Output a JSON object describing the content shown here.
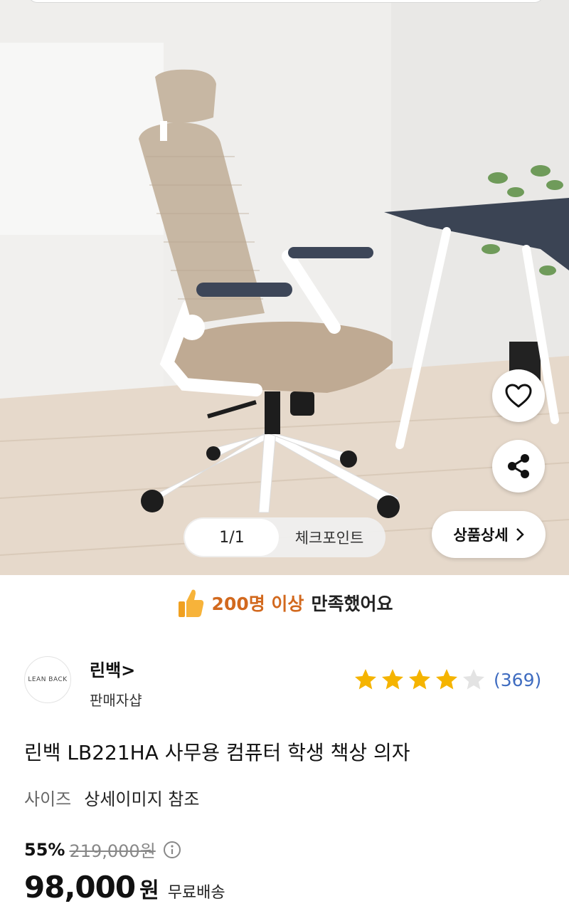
{
  "hero": {
    "page_indicator": "1/1",
    "checkpoint_label": "체크포인트",
    "detail_button_label": "상품상세"
  },
  "satisfaction": {
    "highlight": "200명 이상",
    "rest": "만족했어요"
  },
  "seller": {
    "logo_text": "LEAN BACK",
    "name": "린백>",
    "subtitle": "판매자샵",
    "rating_stars": 4,
    "rating_max": 5,
    "review_count": "(369)"
  },
  "product": {
    "title": "린백 LB221HA 사무용 컴퓨터 학생 책상 의자",
    "option_key": "사이즈",
    "option_value": "상세이미지 참조",
    "discount": "55%",
    "original_price": "219,000원",
    "price": "98,000",
    "currency": "원",
    "shipping": "무료배송"
  },
  "colors": {
    "star_filled": "#f5b400",
    "star_empty": "#e3e3e3",
    "review_link": "#3f6cc0",
    "satisfaction_highlight": "#d2691e"
  }
}
